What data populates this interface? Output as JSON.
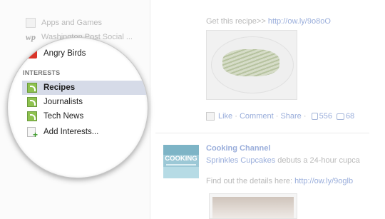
{
  "sidebar": {
    "apps_items": [
      {
        "label": "Apps and Games",
        "icon": "apps-icon"
      },
      {
        "label": "Washington Post Social ...",
        "icon": "washington-post-icon"
      },
      {
        "label": "Angry Birds",
        "icon": "angry-birds-icon"
      }
    ],
    "interests_heading": "INTERESTS",
    "interests": [
      {
        "label": "Recipes",
        "icon": "feed-list-icon",
        "selected": true
      },
      {
        "label": "Journalists",
        "icon": "feed-list-icon"
      },
      {
        "label": "Tech News",
        "icon": "feed-list-icon"
      },
      {
        "label": "Add Interests...",
        "icon": "add-list-icon"
      }
    ]
  },
  "feed": {
    "post1": {
      "text": "Get this recipe>> ",
      "link": "http://ow.ly/9o8oO",
      "actions": {
        "like": "Like",
        "sep1": " · ",
        "comment": "Comment",
        "sep2": " · ",
        "share": "Share",
        "sep3": " · ",
        "likes_count": "556",
        "comments_count": "68"
      }
    },
    "post2": {
      "page_name": "Cooking Channel",
      "avatar_text": "COOKING",
      "headline_link": "Sprinkles Cupcakes",
      "headline_rest": " debuts a 24-hour cupca",
      "details_text": "Find out the details here: ",
      "details_link": "http://ow.ly/9oglb"
    }
  },
  "colors": {
    "link_faded": "#9aaedb",
    "selected_bg": "#d6dbe8",
    "feed_icon_green": "#8ec24f",
    "avatar_blue": "#9cc8d6"
  }
}
